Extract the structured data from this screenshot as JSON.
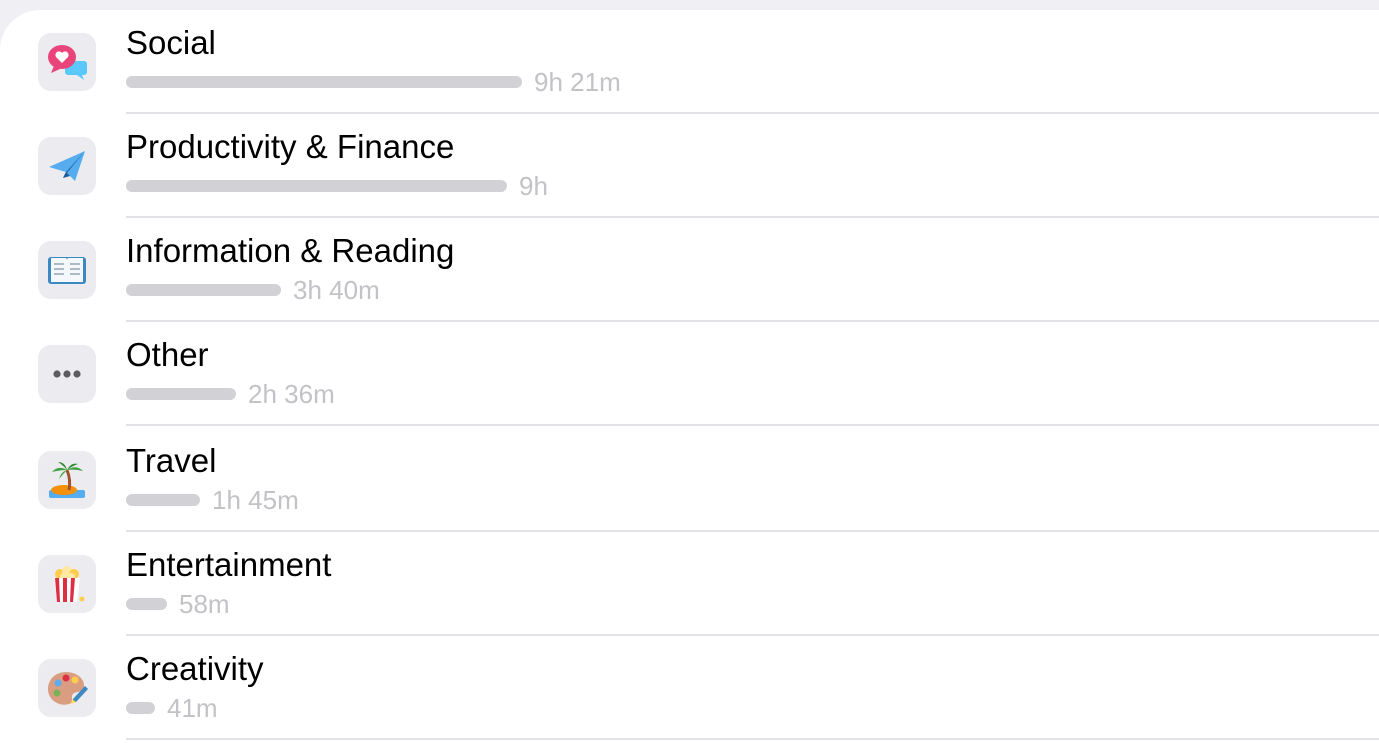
{
  "categories": [
    {
      "label": "Social",
      "duration": "9h 21m",
      "usage_fraction": 1.0,
      "icon": "social-speech-bubbles-heart-icon"
    },
    {
      "label": "Productivity & Finance",
      "duration": "9h",
      "usage_fraction": 0.962,
      "icon": "paper-plane-icon"
    },
    {
      "label": "Information & Reading",
      "duration": "3h 40m",
      "usage_fraction": 0.392,
      "icon": "open-book-icon"
    },
    {
      "label": "Other",
      "duration": "2h 36m",
      "usage_fraction": 0.278,
      "icon": "more-dots-icon"
    },
    {
      "label": "Travel",
      "duration": "1h 45m",
      "usage_fraction": 0.187,
      "icon": "desert-island-icon"
    },
    {
      "label": "Entertainment",
      "duration": "58m",
      "usage_fraction": 0.103,
      "icon": "popcorn-icon"
    },
    {
      "label": "Creativity",
      "duration": "41m",
      "usage_fraction": 0.073,
      "icon": "artist-palette-icon"
    }
  ],
  "colors": {
    "bar": "#d1d1d6",
    "duration_text": "#c2c2c7",
    "icon_tile": "#ebebf0",
    "separator": "#e2e2e7"
  }
}
